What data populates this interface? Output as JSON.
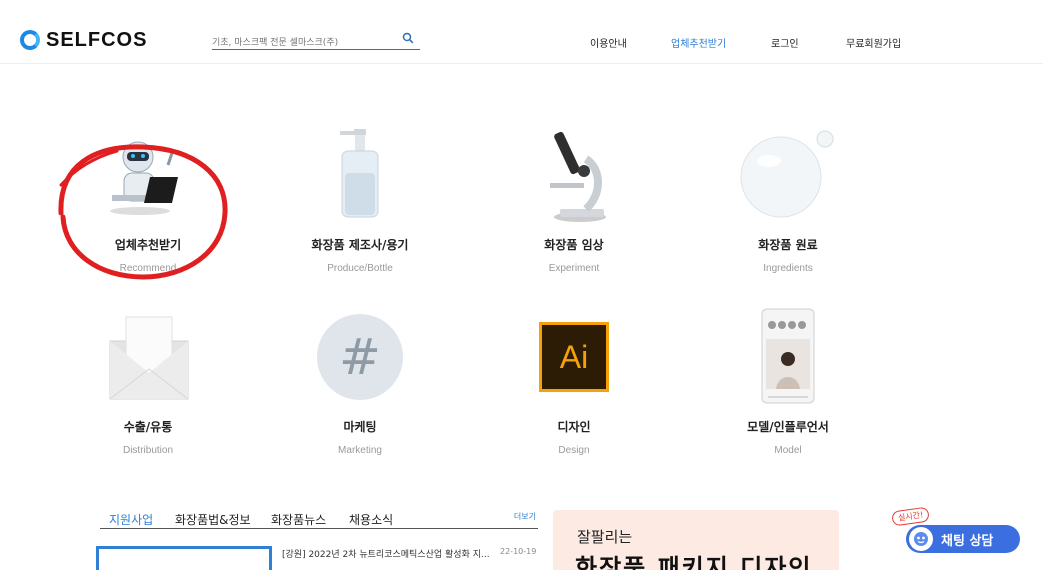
{
  "header": {
    "logo_text": "SELFCOS",
    "search_placeholder": "기초, 마스크팩 전문 셀마스크(주)",
    "nav": [
      "이용안내",
      "업체추천받기",
      "로그인",
      "무료회원가입"
    ]
  },
  "services": [
    {
      "title": "업체추천받기",
      "sub": "Recommend"
    },
    {
      "title": "화장품 제조사/용기",
      "sub": "Produce/Bottle"
    },
    {
      "title": "화장품 임상",
      "sub": "Experiment"
    },
    {
      "title": "화장품 원료",
      "sub": "Ingredients"
    },
    {
      "title": "수출/유통",
      "sub": "Distribution"
    },
    {
      "title": "마케팅",
      "sub": "Marketing"
    },
    {
      "title": "디자인",
      "sub": "Design"
    },
    {
      "title": "모델/인플루언서",
      "sub": "Model"
    }
  ],
  "icons": {
    "design_text": "Ai",
    "marketing_text": "#"
  },
  "news": {
    "tabs": [
      "지원사업",
      "화장품법&정보",
      "화장품뉴스",
      "채용소식"
    ],
    "more": "더보기",
    "item_title": "[강원] 2022년 2차 뉴트리코스메틱스산업 활성화 지...",
    "item_date": "22-10-19"
  },
  "banner": {
    "line1": "잘팔리는",
    "line2": "화장품 패키지 디자인"
  },
  "chat": {
    "badge": "실시간!",
    "label": "채팅 상담"
  },
  "colors": {
    "accent": "#2f7fd6",
    "highlight_circle": "#e02020",
    "chat": "#3b6fe0"
  }
}
